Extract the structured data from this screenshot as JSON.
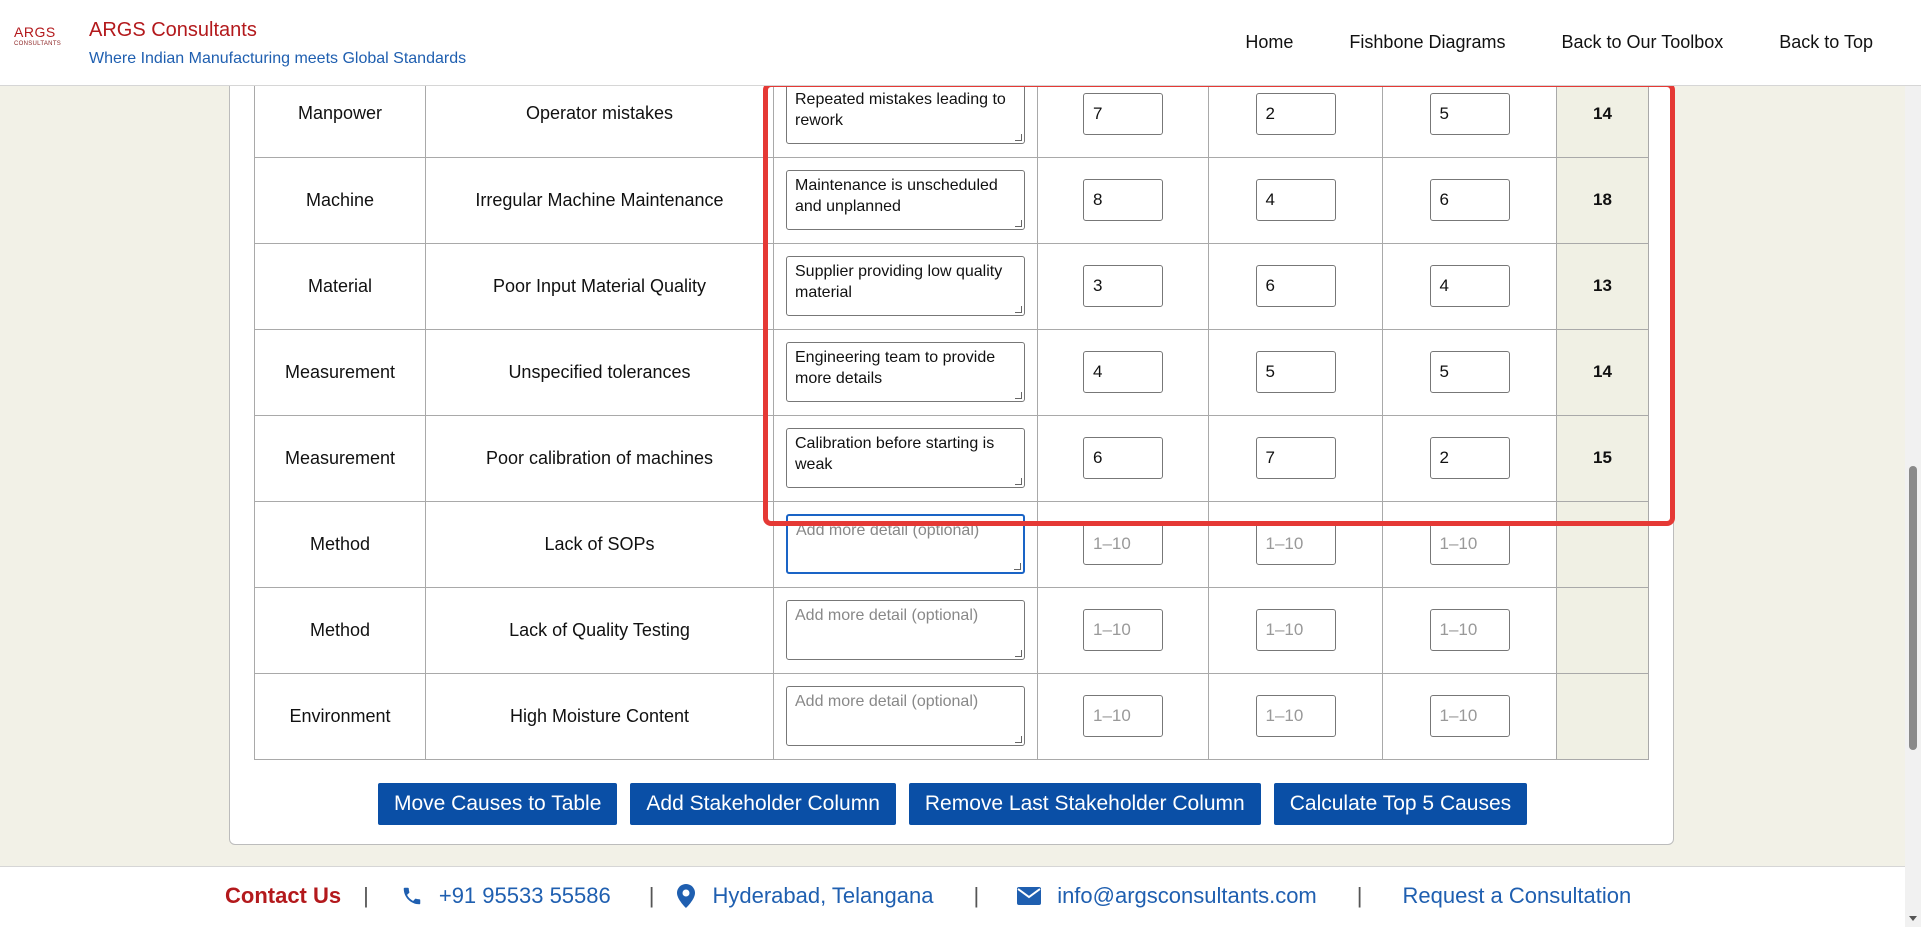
{
  "header": {
    "logo_text": "ARGS",
    "logo_subtext": "CONSULTANTS",
    "brand_name": "ARGS Consultants",
    "tagline": "Where Indian Manufacturing meets Global Standards",
    "nav": [
      "Home",
      "Fishbone Diagrams",
      "Back to Our Toolbox",
      "Back to Top"
    ]
  },
  "table": {
    "rows": [
      {
        "category": "Manpower",
        "cause": "Operator mistakes",
        "detail": "Repeated mistakes leading to rework",
        "s1": "7",
        "s2": "2",
        "s3": "5",
        "score": "14"
      },
      {
        "category": "Machine",
        "cause": "Irregular Machine Maintenance",
        "detail": "Maintenance is unscheduled and unplanned",
        "s1": "8",
        "s2": "4",
        "s3": "6",
        "score": "18"
      },
      {
        "category": "Material",
        "cause": "Poor Input Material Quality",
        "detail": "Supplier providing low quality material",
        "s1": "3",
        "s2": "6",
        "s3": "4",
        "score": "13"
      },
      {
        "category": "Measurement",
        "cause": "Unspecified tolerances",
        "detail": "Engineering team to provide more details",
        "s1": "4",
        "s2": "5",
        "s3": "5",
        "score": "14"
      },
      {
        "category": "Measurement",
        "cause": "Poor calibration of machines",
        "detail": "Calibration before starting is weak",
        "s1": "6",
        "s2": "7",
        "s3": "2",
        "score": "15"
      },
      {
        "category": "Method",
        "cause": "Lack of SOPs",
        "detail": "",
        "s1": "",
        "s2": "",
        "s3": "",
        "score": ""
      },
      {
        "category": "Method",
        "cause": "Lack of Quality Testing",
        "detail": "",
        "s1": "",
        "s2": "",
        "s3": "",
        "score": ""
      },
      {
        "category": "Environment",
        "cause": "High Moisture Content",
        "detail": "",
        "s1": "",
        "s2": "",
        "s3": "",
        "score": ""
      }
    ],
    "detail_placeholder": "Add more detail (optional)",
    "score_placeholder": "1–10"
  },
  "buttons": {
    "move": "Move Causes to Table",
    "add": "Add Stakeholder Column",
    "remove": "Remove Last Stakeholder Column",
    "calc": "Calculate Top 5 Causes"
  },
  "footer": {
    "contact": "Contact Us",
    "sep": "|",
    "phone": "+91 95533 55586",
    "location": "Hyderabad, Telangana",
    "email": "info@argsconsultants.com",
    "consult": "Request a Consultation"
  },
  "colors": {
    "brand_red": "#b3191c",
    "brand_blue": "#1f5fb0",
    "button_blue": "#0a4fa6",
    "highlight_red": "#e53935"
  }
}
